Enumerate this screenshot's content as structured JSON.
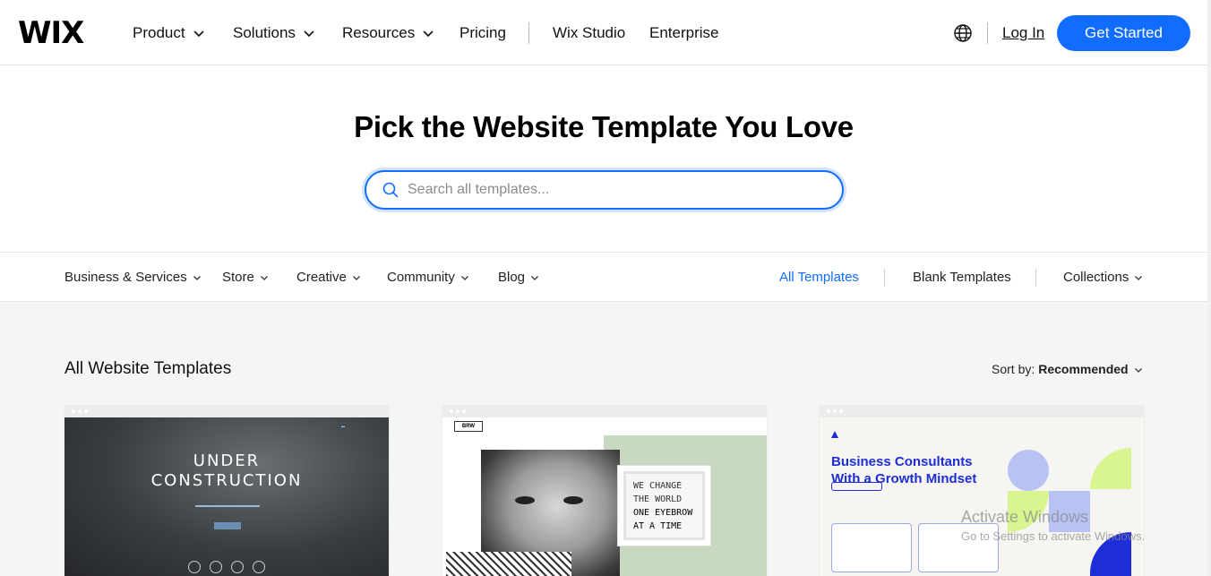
{
  "nav": {
    "logo": "WIX",
    "items": [
      {
        "label": "Product",
        "dropdown": true
      },
      {
        "label": "Solutions",
        "dropdown": true
      },
      {
        "label": "Resources",
        "dropdown": true
      },
      {
        "label": "Pricing",
        "dropdown": false
      },
      {
        "label": "Wix Studio",
        "dropdown": false
      },
      {
        "label": "Enterprise",
        "dropdown": false
      }
    ],
    "login_label": "Log In",
    "cta_label": "Get Started",
    "globe_icon": "globe-icon"
  },
  "hero": {
    "title": "Pick the Website Template You Love",
    "search_placeholder": "Search all templates...",
    "search_value": ""
  },
  "categories": {
    "left": [
      {
        "label": "Business & Services"
      },
      {
        "label": "Store"
      },
      {
        "label": "Creative"
      },
      {
        "label": "Community"
      },
      {
        "label": "Blog"
      }
    ],
    "right": [
      {
        "label": "All Templates",
        "active": true
      },
      {
        "label": "Blank Templates",
        "active": false
      },
      {
        "label": "Collections",
        "active": false
      }
    ]
  },
  "listing": {
    "title": "All Website Templates",
    "sort_prefix": "Sort by:",
    "sort_value": "Recommended"
  },
  "templates": [
    {
      "id": "under-construction",
      "line1": "UNDER",
      "line2": "CONSTRUCTION"
    },
    {
      "id": "brw-eyebrow",
      "logo_text": "BRW",
      "text": [
        "WE CHANGE",
        "THE WORLD",
        "ONE EYEBROW",
        "AT A TIME"
      ]
    },
    {
      "id": "business-consultants",
      "headline_1": "Business Consultants",
      "headline_2": "With a Growth Mindset"
    }
  ],
  "watermark": {
    "line1": "Activate Windows",
    "line2": "Go to Settings to activate Windows."
  },
  "colors": {
    "accent": "#116dff",
    "sage": "#c9d9c1",
    "consult_blue": "#1d2dd8",
    "lime": "#d8f58f"
  }
}
